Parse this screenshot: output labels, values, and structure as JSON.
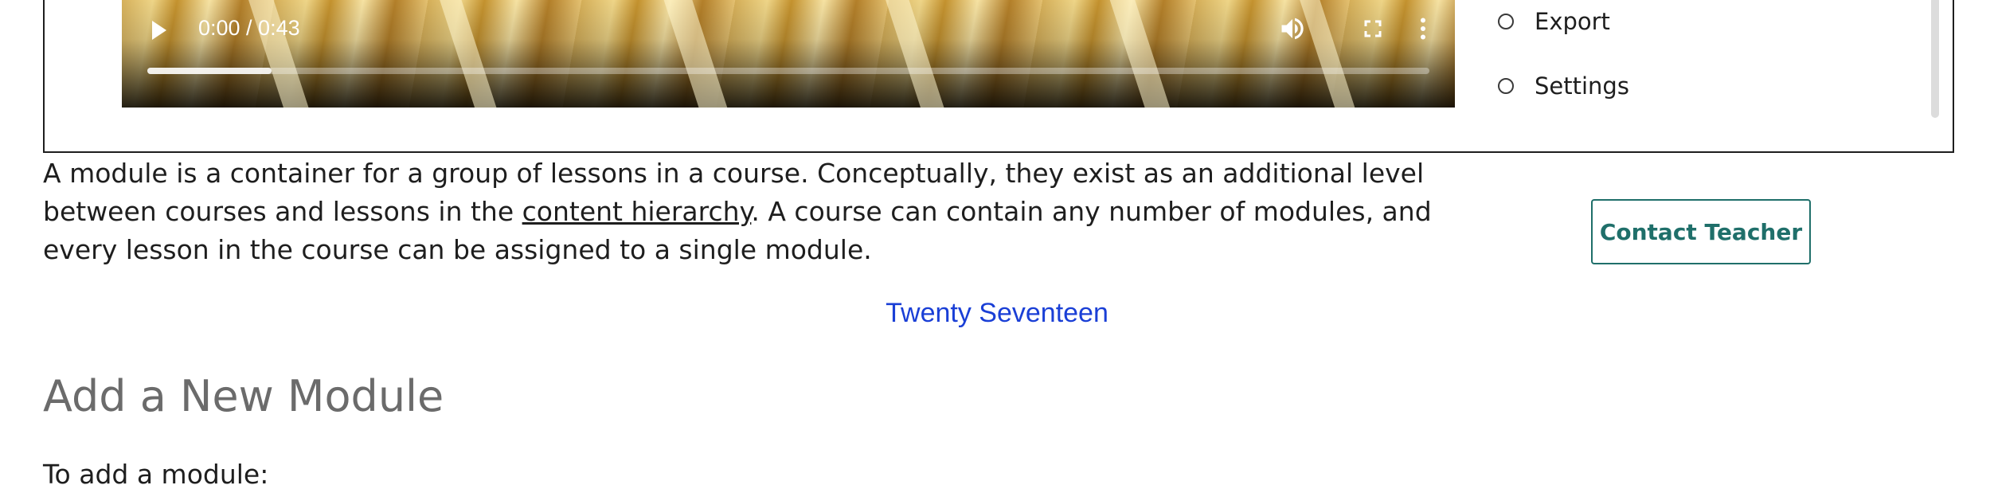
{
  "video": {
    "time": "0:00 / 0:43",
    "progress_fraction": 0.097
  },
  "lesson_nav": {
    "items": [
      {
        "label": "Export"
      },
      {
        "label": "Settings"
      }
    ]
  },
  "content": {
    "intro_before_link": "A module is a container for a group of lessons in a course. Conceptually, they exist as an additional level between courses and lessons in the ",
    "intro_link": "content hierarchy",
    "intro_after_link": ". A course can contain any number of modules, and every lesson in the course can be assigned to a single module.",
    "contact_button": "Contact Teacher",
    "theme_link": "Twenty Seventeen",
    "section_title": "Add a New Module",
    "section_intro": "To add a module:"
  },
  "colors": {
    "accent": "#1f6f6a",
    "link": "#1a3fd6",
    "heading": "#6b6b6b"
  },
  "icons": {
    "play": "play-icon",
    "volume": "volume-icon",
    "fullscreen": "fullscreen-icon",
    "more": "more-vertical-icon"
  }
}
